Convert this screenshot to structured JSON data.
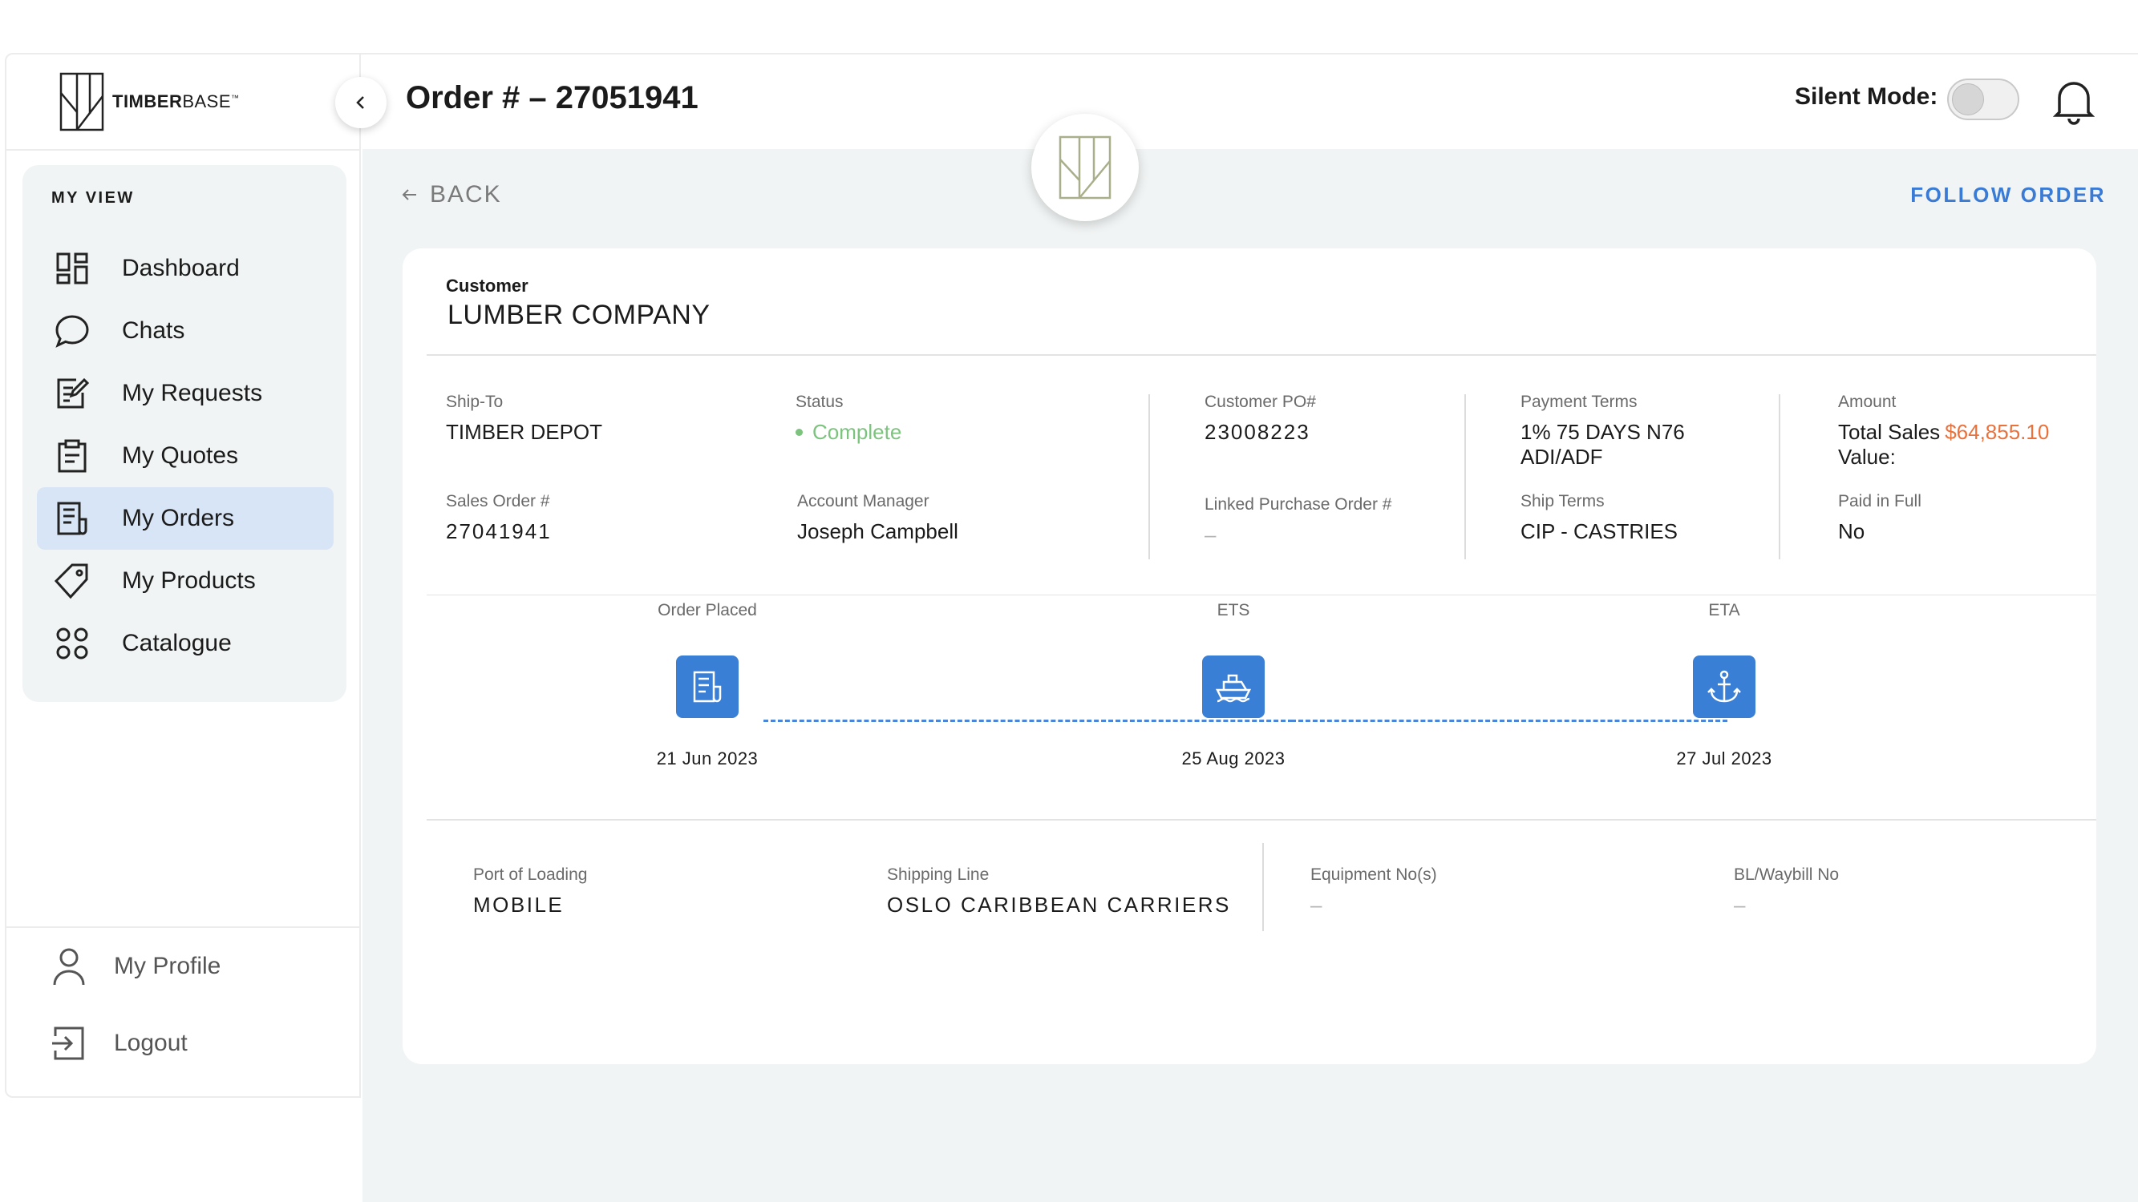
{
  "brand": {
    "name_bold": "TIMBER",
    "name_regular": "BASE",
    "trademark": "™"
  },
  "sidebar": {
    "section_title": "MY VIEW",
    "items": [
      {
        "label": "Dashboard",
        "icon": "dashboard-icon"
      },
      {
        "label": "Chats",
        "icon": "chat-bubble-icon"
      },
      {
        "label": "My Requests",
        "icon": "request-edit-icon"
      },
      {
        "label": "My Quotes",
        "icon": "clipboard-icon"
      },
      {
        "label": "My Orders",
        "icon": "document-list-icon",
        "active": true
      },
      {
        "label": "My Products",
        "icon": "tag-icon"
      },
      {
        "label": "Catalogue",
        "icon": "grid-circles-icon"
      }
    ],
    "bottom": [
      {
        "label": "My Profile",
        "icon": "user-icon"
      },
      {
        "label": "Logout",
        "icon": "logout-icon"
      }
    ]
  },
  "header": {
    "title": "Order # – 27051941",
    "silent_mode_label": "Silent Mode:",
    "silent_mode_on": false
  },
  "main": {
    "back_label": "BACK",
    "follow_label": "FOLLOW ORDER"
  },
  "order": {
    "customer_label": "Customer",
    "customer": "LUMBER COMPANY",
    "ship_to_label": "Ship-To",
    "ship_to": "TIMBER DEPOT",
    "status_label": "Status",
    "status": "Complete",
    "sales_order_label": "Sales Order #",
    "sales_order": "27041941",
    "account_manager_label": "Account Manager",
    "account_manager": "Joseph Campbell",
    "customer_po_label": "Customer PO#",
    "customer_po": "23008223",
    "linked_po_label": "Linked Purchase Order #",
    "linked_po": "–",
    "payment_terms_label": "Payment Terms",
    "payment_terms_line1": "1% 75 DAYS N76",
    "payment_terms_line2": "ADI/ADF",
    "ship_terms_label": "Ship Terms",
    "ship_terms": "CIP - CASTRIES",
    "amount_label": "Amount",
    "total_sales_label": "Total Sales",
    "total_sales_label2": "Value:",
    "total_sales_value": "$64,855.10",
    "paid_in_full_label": "Paid in Full",
    "paid_in_full": "No"
  },
  "timeline": [
    {
      "label": "Order Placed",
      "date": "21 Jun 2023",
      "icon": "document-icon"
    },
    {
      "label": "ETS",
      "date": "25 Aug 2023",
      "icon": "ship-icon"
    },
    {
      "label": "ETA",
      "date": "27 Jul 2023",
      "icon": "anchor-icon"
    }
  ],
  "shipping": {
    "port_label": "Port of Loading",
    "port": "MOBILE",
    "line_label": "Shipping Line",
    "line": "OSLO CARIBBEAN CARRIERS",
    "equipment_label": "Equipment No(s)",
    "equipment": "–",
    "bl_label": "BL/Waybill No",
    "bl": "–"
  },
  "colors": {
    "accent_blue": "#3a7fd6",
    "active_nav_bg": "#d8e5f6",
    "status_green": "#7cc37e",
    "amount_orange": "#e8713c",
    "logo_olive": "#a9ae8b"
  }
}
